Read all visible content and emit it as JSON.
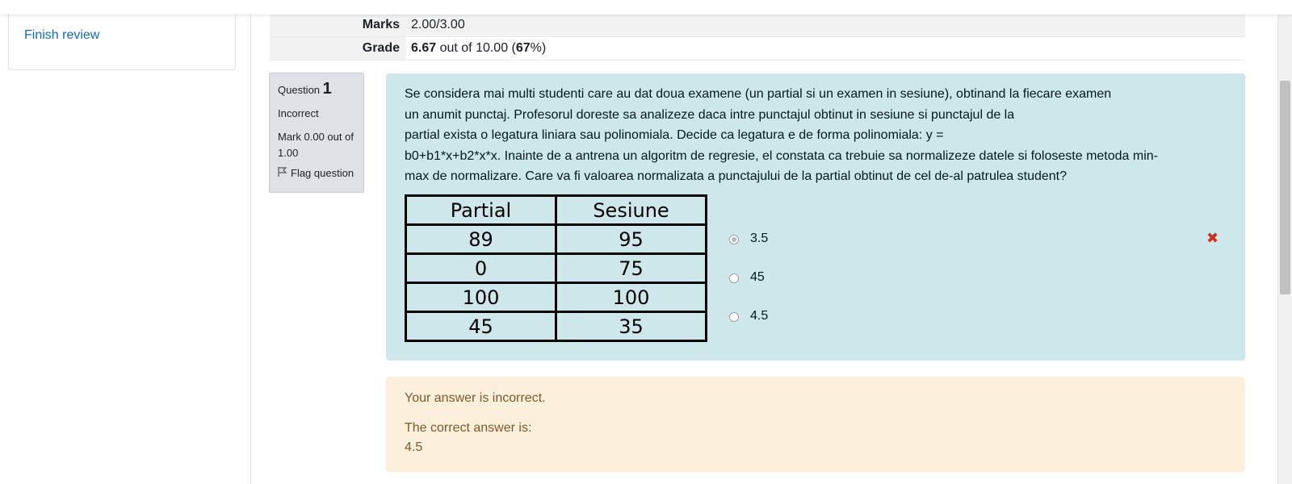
{
  "sidebar": {
    "finish_review": "Finish review"
  },
  "summary": [
    {
      "label": "Marks",
      "value": "2.00/3.00"
    },
    {
      "label": "Grade",
      "value_bold": "6.67",
      "value_mid": " out of 10.00 (",
      "value_pct": "67",
      "value_tail": "%)"
    }
  ],
  "question_info": {
    "question_word": "Question",
    "question_number": "1",
    "state": "Incorrect",
    "mark": "Mark 0.00 out of 1.00",
    "flag_label": "Flag question"
  },
  "question": {
    "lines": [
      "Se considera mai multi studenti care au dat doua examene (un partial si un examen in sesiune), obtinand la fiecare examen",
      "un anumit punctaj. Profesorul doreste sa analizeze daca intre punctajul obtinut in sesiune si punctajul de la",
      "partial exista o legatura liniara sau polinomiala. Decide ca legatura e de forma polinomiala: y =",
      "b0+b1*x+b2*x*x. Inainte de a antrena un algoritm de regresie, el constata ca trebuie sa normalizeze datele si foloseste metoda min-",
      "max de normalizare. Care va fi valoarea normalizata a punctajului de la partial obtinut de cel de-al patrulea student?"
    ],
    "table": {
      "headers": [
        "Partial",
        "Sesiune"
      ],
      "rows": [
        [
          "89",
          "95"
        ],
        [
          "0",
          "75"
        ],
        [
          "100",
          "100"
        ],
        [
          "45",
          "35"
        ]
      ]
    },
    "options": [
      {
        "label": "3.5",
        "selected": true
      },
      {
        "label": "45",
        "selected": false
      },
      {
        "label": "4.5",
        "selected": false
      }
    ]
  },
  "feedback": {
    "incorrect_msg": "Your answer is incorrect.",
    "correct_label": "The correct answer is:",
    "correct_value": "4.5"
  },
  "colors": {
    "link": "#0f6cbf",
    "question_bg": "#cde7eb",
    "feedback_bg": "#fcefdc",
    "incorrect_icon": "#ca3120"
  },
  "icons": {
    "incorrect": "close-icon",
    "flag": "flag-icon"
  }
}
